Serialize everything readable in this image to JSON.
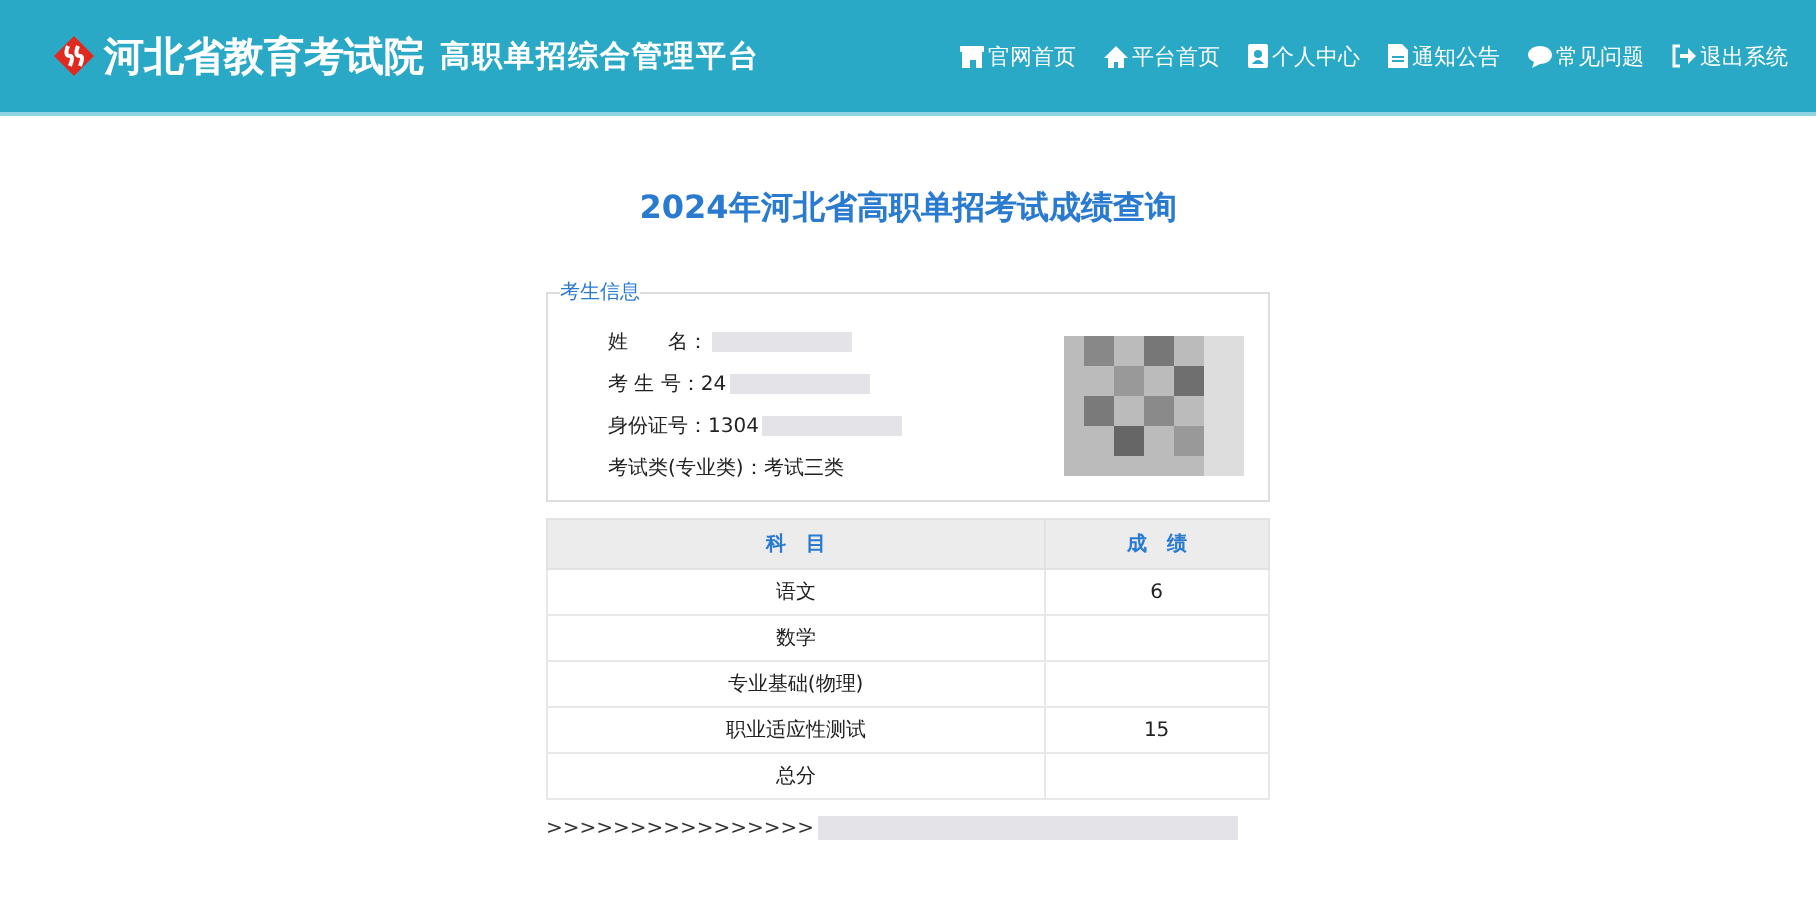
{
  "header": {
    "logo_title": "河北省教育考试院",
    "subtitle": "高职单招综合管理平台",
    "nav": [
      {
        "label": "官网首页"
      },
      {
        "label": "平台首页"
      },
      {
        "label": "个人中心"
      },
      {
        "label": "通知公告"
      },
      {
        "label": "常见问题"
      },
      {
        "label": "退出系统"
      }
    ]
  },
  "page_title": "2024年河北省高职单招考试成绩查询",
  "student_info": {
    "legend": "考生信息",
    "fields": [
      {
        "label": "姓　　名："
      },
      {
        "label": "考 生 号：",
        "value": "24"
      },
      {
        "label": "身份证号：",
        "value": "1304"
      },
      {
        "label": "考试类(专业类)：",
        "value": "考试三类"
      }
    ]
  },
  "scores": {
    "columns": [
      "科　目",
      "成　绩"
    ],
    "rows": [
      {
        "subject": "语文",
        "score": "6"
      },
      {
        "subject": "数学"
      },
      {
        "subject": "专业基础(物理)"
      },
      {
        "subject": "职业适应性测试",
        "score": "15"
      },
      {
        "subject": "总分"
      }
    ]
  },
  "footer_text": ">>>>>>>>>>>>>>>>"
}
